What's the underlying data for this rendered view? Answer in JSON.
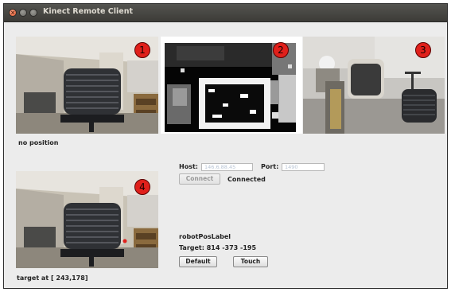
{
  "window": {
    "title": "Kinect Remote Client",
    "buttons": [
      "close",
      "minimize",
      "maximize"
    ]
  },
  "feeds": [
    {
      "badge": "1",
      "kind": "rgb-camera"
    },
    {
      "badge": "2",
      "kind": "depth-camera"
    },
    {
      "badge": "3",
      "kind": "robot-camera"
    },
    {
      "badge": "4",
      "kind": "target-camera"
    }
  ],
  "status": {
    "position_text": "no position",
    "target_text": "target at [ 243,178]"
  },
  "connection": {
    "host_label": "Host:",
    "host_value": "146.6.88.45",
    "port_label": "Port:",
    "port_value": "1490",
    "connect_label": "Connect",
    "connected_text": "Connected"
  },
  "robot": {
    "pos_label": "robotPosLabel",
    "target_text": "Target: 814 -373 -195",
    "default_label": "Default",
    "touch_label": "Touch"
  },
  "colors": {
    "titlebar": "#3c3b37",
    "close_button": "#e2562b",
    "badge": "#e0201b",
    "window_bg": "#ececec"
  }
}
